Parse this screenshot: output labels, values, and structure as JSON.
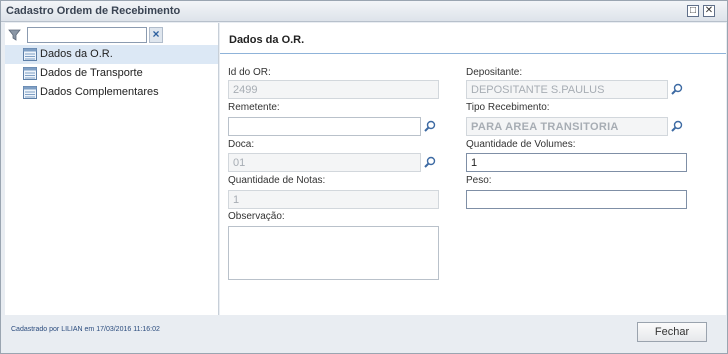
{
  "window": {
    "title": "Cadastro Ordem de Recebimento"
  },
  "sidebar": {
    "filter": {
      "value": "",
      "placeholder": ""
    },
    "items": [
      {
        "label": "Dados da O.R.",
        "selected": true
      },
      {
        "label": "Dados de Transporte",
        "selected": false
      },
      {
        "label": "Dados Complementares",
        "selected": false
      }
    ]
  },
  "panel": {
    "title": "Dados da O.R.",
    "fields": {
      "id_or": {
        "label": "Id do OR:",
        "value": "2499"
      },
      "depositante": {
        "label": "Depositante:",
        "value": "DEPOSITANTE S.PAULUS"
      },
      "remetente": {
        "label": "Remetente:",
        "value": ""
      },
      "tipo_recebimento": {
        "label": "Tipo Recebimento:",
        "value": "PARA AREA TRANSITORIA"
      },
      "doca": {
        "label": "Doca:",
        "value": "01"
      },
      "quantidade_volumes": {
        "label": "Quantidade de Volumes:",
        "value": "1"
      },
      "quantidade_notas": {
        "label": "Quantidade de Notas:",
        "value": "1"
      },
      "peso": {
        "label": "Peso:",
        "value": ""
      },
      "observacao": {
        "label": "Observação:",
        "value": ""
      }
    }
  },
  "footer": {
    "status_text": "Cadastrado por LILIAN em 17/03/2016 11:16:02",
    "close_label": "Fechar"
  },
  "colors": {
    "selected_row": "#dce8f5",
    "accent_line": "#8fb3d9",
    "footer_text": "#2b4c7e"
  },
  "icons": [
    "filter-icon",
    "clear-icon",
    "form-icon",
    "search-icon",
    "maximize-icon",
    "close-icon"
  ]
}
